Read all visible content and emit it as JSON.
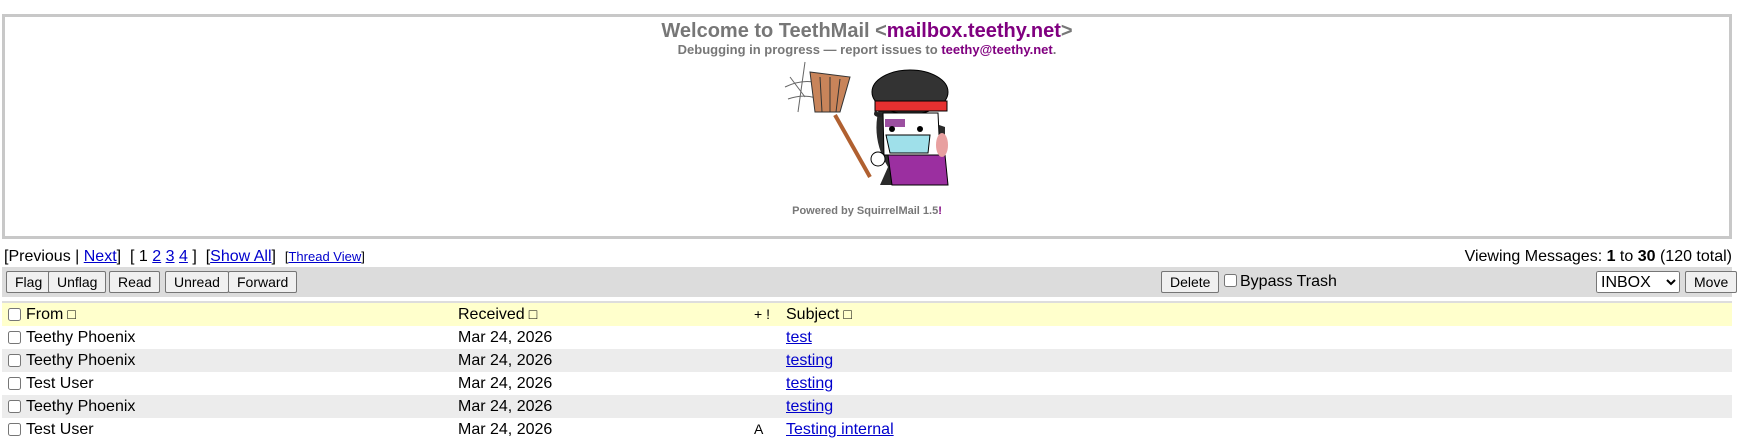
{
  "banner": {
    "title_prefix": "Welcome to TeethMail <",
    "title_domain": "mailbox.teethy.net",
    "title_suffix": ">",
    "subtitle_prefix": "Debugging in progress — report issues to ",
    "subtitle_email": "teethy@teethy.net",
    "subtitle_suffix": ".",
    "powered_prefix": "Powered by SquirrelMail 1.5",
    "powered_suffix": "!"
  },
  "paging": {
    "open_bracket": "[",
    "previous": "Previous",
    "sep": " | ",
    "next": "Next",
    "close_bracket": "]",
    "page_open": "[",
    "current_page": "1",
    "pages": [
      "2",
      "3",
      "4"
    ],
    "page_close": "]",
    "showall_open": "[",
    "show_all": "Show All",
    "showall_close": "]",
    "thread_open": "[",
    "thread_view": "Thread View",
    "thread_close": "]"
  },
  "viewing": {
    "prefix": "Viewing Messages: ",
    "start": "1",
    "to": " to ",
    "end": "30",
    "total": " (120 total)"
  },
  "toolbar": {
    "flag": "Flag",
    "unflag": "Unflag",
    "read": "Read",
    "unread": "Unread",
    "forward": "Forward",
    "delete": "Delete",
    "bypass_trash": "Bypass Trash",
    "folder_selected": "INBOX",
    "move": "Move"
  },
  "columns": {
    "from": "From",
    "received": "Received",
    "flags": "+ !",
    "subject": "Subject",
    "sort_glyph": "□"
  },
  "messages": [
    {
      "from": "Teethy Phoenix",
      "received": "Mar 24, 2026",
      "flags": "",
      "subject": "test"
    },
    {
      "from": "Teethy Phoenix",
      "received": "Mar 24, 2026",
      "flags": "",
      "subject": "testing"
    },
    {
      "from": "Test User",
      "received": "Mar 24, 2026",
      "flags": "",
      "subject": "testing"
    },
    {
      "from": "Teethy Phoenix",
      "received": "Mar 24, 2026",
      "flags": "",
      "subject": "testing"
    },
    {
      "from": "Test User",
      "received": "Mar 24, 2026",
      "flags": "A",
      "subject": "Testing internal"
    }
  ],
  "colors": {
    "accent_purple": "#800080",
    "link_blue": "#0000cc",
    "header_row": "#ffffcc",
    "toolbar_bg": "#dcdcdc",
    "alt_row": "#ececec"
  }
}
